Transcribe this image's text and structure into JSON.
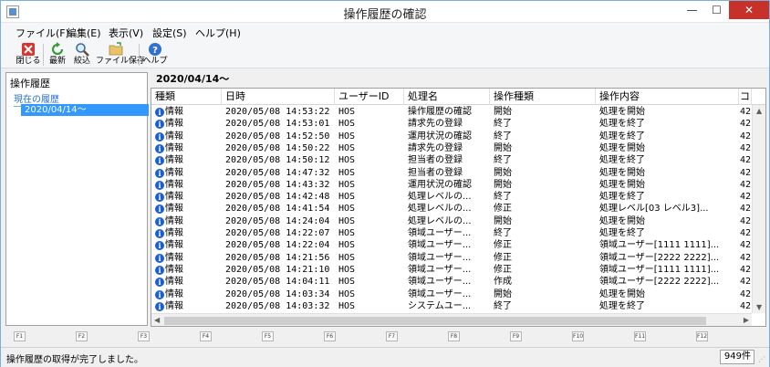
{
  "window": {
    "title": "操作履歴の確認"
  },
  "menu": [
    {
      "label": "ファイル(F)"
    },
    {
      "label": "編集(E)"
    },
    {
      "label": "表示(V)"
    },
    {
      "label": "設定(S)"
    },
    {
      "label": "ヘルプ(H)"
    }
  ],
  "toolbar": {
    "close_label": "閉じる",
    "refresh_label": "最新",
    "filter_label": "絞込",
    "save_label": "ファイル保存",
    "help_label": "ヘルプ"
  },
  "left_panel": {
    "title": "操作履歴",
    "section": "現在の履歴",
    "selected": "2020/04/14～"
  },
  "grid": {
    "heading": "2020/04/14～",
    "columns": [
      "種類",
      "日時",
      "ユーザーID",
      "処理名",
      "操作種類",
      "操作内容",
      "コ"
    ],
    "rows": [
      [
        "情報",
        "2020/05/08 14:53:22",
        "HOS",
        "操作履歴の確認",
        "開始",
        "処理を開始",
        "42"
      ],
      [
        "情報",
        "2020/05/08 14:53:01",
        "HOS",
        "請求先の登録",
        "終了",
        "処理を終了",
        "42"
      ],
      [
        "情報",
        "2020/05/08 14:52:50",
        "HOS",
        "運用状況の確認",
        "終了",
        "処理を終了",
        "42"
      ],
      [
        "情報",
        "2020/05/08 14:50:22",
        "HOS",
        "請求先の登録",
        "開始",
        "処理を開始",
        "42"
      ],
      [
        "情報",
        "2020/05/08 14:50:12",
        "HOS",
        "担当者の登録",
        "終了",
        "処理を終了",
        "42"
      ],
      [
        "情報",
        "2020/05/08 14:47:32",
        "HOS",
        "担当者の登録",
        "開始",
        "処理を開始",
        "42"
      ],
      [
        "情報",
        "2020/05/08 14:43:32",
        "HOS",
        "運用状況の確認",
        "開始",
        "処理を開始",
        "42"
      ],
      [
        "情報",
        "2020/05/08 14:42:48",
        "HOS",
        "処理レベルの...",
        "終了",
        "処理を終了",
        "42"
      ],
      [
        "情報",
        "2020/05/08 14:41:54",
        "HOS",
        "処理レベルの...",
        "修正",
        "処理レベル[03 レベル3]...",
        "42"
      ],
      [
        "情報",
        "2020/05/08 14:24:04",
        "HOS",
        "処理レベルの...",
        "開始",
        "処理を開始",
        "42"
      ],
      [
        "情報",
        "2020/05/08 14:22:07",
        "HOS",
        "領域ユーザー...",
        "終了",
        "処理を終了",
        "42"
      ],
      [
        "情報",
        "2020/05/08 14:22:04",
        "HOS",
        "領域ユーザー...",
        "修正",
        "領域ユーザー[1111 1111]...",
        "42"
      ],
      [
        "情報",
        "2020/05/08 14:21:56",
        "HOS",
        "領域ユーザー...",
        "修正",
        "領域ユーザー[2222 2222]...",
        "42"
      ],
      [
        "情報",
        "2020/05/08 14:21:10",
        "HOS",
        "領域ユーザー...",
        "修正",
        "領域ユーザー[1111 1111]...",
        "42"
      ],
      [
        "情報",
        "2020/05/08 14:04:11",
        "HOS",
        "領域ユーザー...",
        "作成",
        "領域ユーザー[2222 2222]...",
        "42"
      ],
      [
        "情報",
        "2020/05/08 14:03:34",
        "HOS",
        "領域ユーザー...",
        "開始",
        "処理を開始",
        "42"
      ],
      [
        "情報",
        "2020/05/08 14:03:32",
        "HOS",
        "システムユー...",
        "終了",
        "処理を終了",
        "42"
      ]
    ]
  },
  "fkeys": [
    "F1",
    "F2",
    "F3",
    "F4",
    "F5",
    "F6",
    "F7",
    "F8",
    "F9",
    "F10",
    "F11",
    "F12"
  ],
  "status": {
    "message": "操作履歴の取得が完了しました。",
    "count": "949件"
  },
  "colors": {
    "selection": "#3399ff",
    "info_icon": "#1b5fcf",
    "close_button": "#c7312a"
  }
}
